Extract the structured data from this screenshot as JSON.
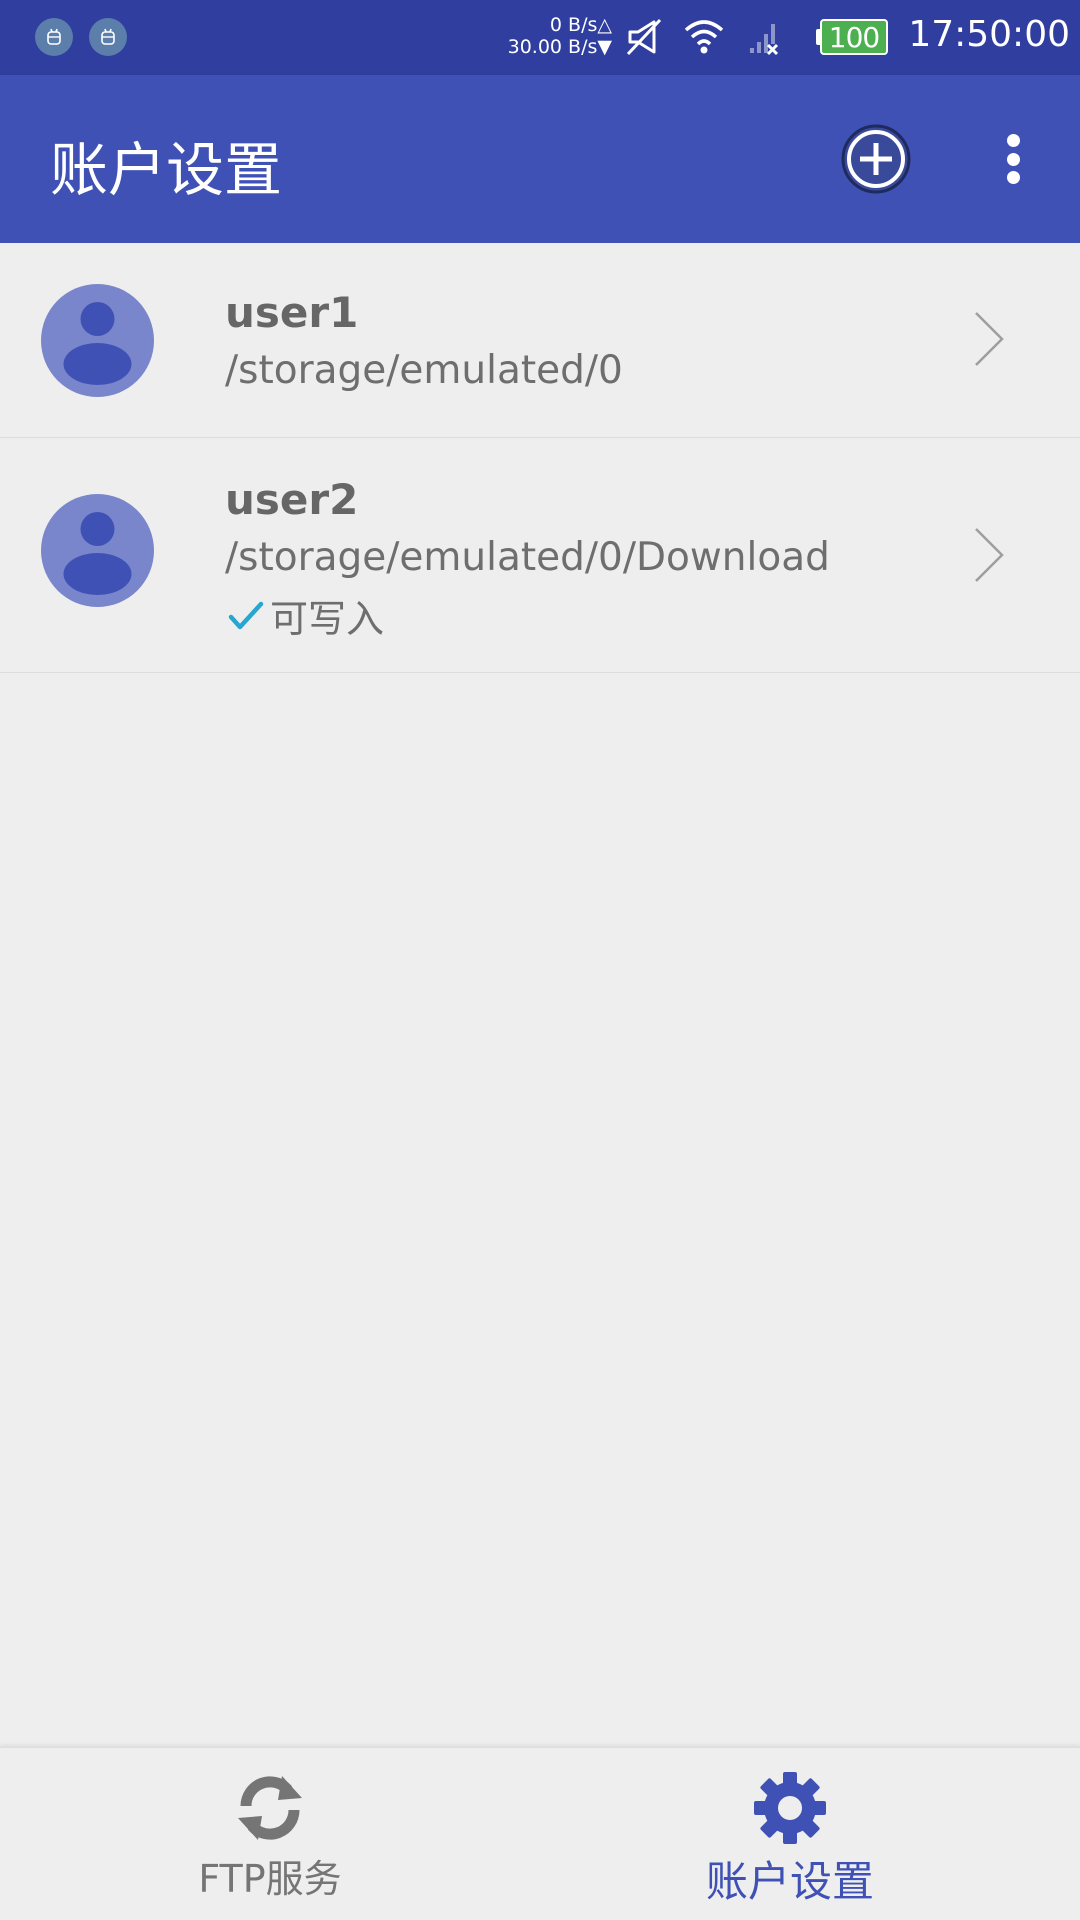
{
  "status_bar": {
    "notification_icons": [
      "android-debug-icon",
      "android-debug-icon"
    ],
    "upload_speed": "0 B/s△",
    "download_speed": "30.00 B/s▼",
    "battery_level": "100",
    "time": "17:50:00"
  },
  "app_bar": {
    "title": "账户设置",
    "add_icon": "add-circle-icon",
    "more_icon": "more-vertical-icon"
  },
  "accounts": [
    {
      "name": "user1",
      "path": "/storage/emulated/0",
      "writable_label": ""
    },
    {
      "name": "user2",
      "path": "/storage/emulated/0/Download",
      "writable_label": "可写入"
    }
  ],
  "bottom_nav": {
    "items": [
      {
        "label": "FTP服务",
        "icon": "sync-icon",
        "active": false
      },
      {
        "label": "账户设置",
        "icon": "gear-icon",
        "active": true
      }
    ]
  },
  "colors": {
    "status_bar": "#303f9f",
    "primary": "#3f51b5",
    "avatar": "#7986cb",
    "check": "#26a6d1",
    "battery": "#4caf50"
  }
}
